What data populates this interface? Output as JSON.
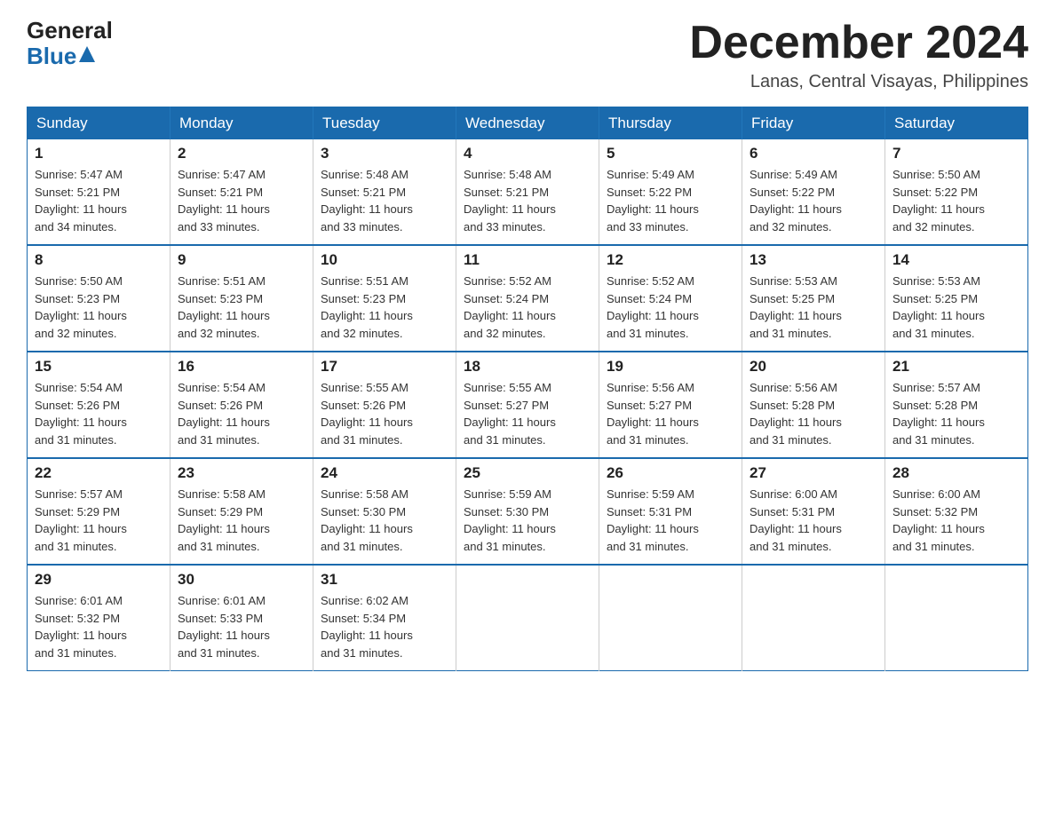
{
  "header": {
    "logo_general": "General",
    "logo_blue": "Blue",
    "month_title": "December 2024",
    "location": "Lanas, Central Visayas, Philippines"
  },
  "calendar": {
    "days_of_week": [
      "Sunday",
      "Monday",
      "Tuesday",
      "Wednesday",
      "Thursday",
      "Friday",
      "Saturday"
    ],
    "weeks": [
      [
        {
          "day": "1",
          "sunrise": "5:47 AM",
          "sunset": "5:21 PM",
          "daylight": "11 hours and 34 minutes."
        },
        {
          "day": "2",
          "sunrise": "5:47 AM",
          "sunset": "5:21 PM",
          "daylight": "11 hours and 33 minutes."
        },
        {
          "day": "3",
          "sunrise": "5:48 AM",
          "sunset": "5:21 PM",
          "daylight": "11 hours and 33 minutes."
        },
        {
          "day": "4",
          "sunrise": "5:48 AM",
          "sunset": "5:21 PM",
          "daylight": "11 hours and 33 minutes."
        },
        {
          "day": "5",
          "sunrise": "5:49 AM",
          "sunset": "5:22 PM",
          "daylight": "11 hours and 33 minutes."
        },
        {
          "day": "6",
          "sunrise": "5:49 AM",
          "sunset": "5:22 PM",
          "daylight": "11 hours and 32 minutes."
        },
        {
          "day": "7",
          "sunrise": "5:50 AM",
          "sunset": "5:22 PM",
          "daylight": "11 hours and 32 minutes."
        }
      ],
      [
        {
          "day": "8",
          "sunrise": "5:50 AM",
          "sunset": "5:23 PM",
          "daylight": "11 hours and 32 minutes."
        },
        {
          "day": "9",
          "sunrise": "5:51 AM",
          "sunset": "5:23 PM",
          "daylight": "11 hours and 32 minutes."
        },
        {
          "day": "10",
          "sunrise": "5:51 AM",
          "sunset": "5:23 PM",
          "daylight": "11 hours and 32 minutes."
        },
        {
          "day": "11",
          "sunrise": "5:52 AM",
          "sunset": "5:24 PM",
          "daylight": "11 hours and 32 minutes."
        },
        {
          "day": "12",
          "sunrise": "5:52 AM",
          "sunset": "5:24 PM",
          "daylight": "11 hours and 31 minutes."
        },
        {
          "day": "13",
          "sunrise": "5:53 AM",
          "sunset": "5:25 PM",
          "daylight": "11 hours and 31 minutes."
        },
        {
          "day": "14",
          "sunrise": "5:53 AM",
          "sunset": "5:25 PM",
          "daylight": "11 hours and 31 minutes."
        }
      ],
      [
        {
          "day": "15",
          "sunrise": "5:54 AM",
          "sunset": "5:26 PM",
          "daylight": "11 hours and 31 minutes."
        },
        {
          "day": "16",
          "sunrise": "5:54 AM",
          "sunset": "5:26 PM",
          "daylight": "11 hours and 31 minutes."
        },
        {
          "day": "17",
          "sunrise": "5:55 AM",
          "sunset": "5:26 PM",
          "daylight": "11 hours and 31 minutes."
        },
        {
          "day": "18",
          "sunrise": "5:55 AM",
          "sunset": "5:27 PM",
          "daylight": "11 hours and 31 minutes."
        },
        {
          "day": "19",
          "sunrise": "5:56 AM",
          "sunset": "5:27 PM",
          "daylight": "11 hours and 31 minutes."
        },
        {
          "day": "20",
          "sunrise": "5:56 AM",
          "sunset": "5:28 PM",
          "daylight": "11 hours and 31 minutes."
        },
        {
          "day": "21",
          "sunrise": "5:57 AM",
          "sunset": "5:28 PM",
          "daylight": "11 hours and 31 minutes."
        }
      ],
      [
        {
          "day": "22",
          "sunrise": "5:57 AM",
          "sunset": "5:29 PM",
          "daylight": "11 hours and 31 minutes."
        },
        {
          "day": "23",
          "sunrise": "5:58 AM",
          "sunset": "5:29 PM",
          "daylight": "11 hours and 31 minutes."
        },
        {
          "day": "24",
          "sunrise": "5:58 AM",
          "sunset": "5:30 PM",
          "daylight": "11 hours and 31 minutes."
        },
        {
          "day": "25",
          "sunrise": "5:59 AM",
          "sunset": "5:30 PM",
          "daylight": "11 hours and 31 minutes."
        },
        {
          "day": "26",
          "sunrise": "5:59 AM",
          "sunset": "5:31 PM",
          "daylight": "11 hours and 31 minutes."
        },
        {
          "day": "27",
          "sunrise": "6:00 AM",
          "sunset": "5:31 PM",
          "daylight": "11 hours and 31 minutes."
        },
        {
          "day": "28",
          "sunrise": "6:00 AM",
          "sunset": "5:32 PM",
          "daylight": "11 hours and 31 minutes."
        }
      ],
      [
        {
          "day": "29",
          "sunrise": "6:01 AM",
          "sunset": "5:32 PM",
          "daylight": "11 hours and 31 minutes."
        },
        {
          "day": "30",
          "sunrise": "6:01 AM",
          "sunset": "5:33 PM",
          "daylight": "11 hours and 31 minutes."
        },
        {
          "day": "31",
          "sunrise": "6:02 AM",
          "sunset": "5:34 PM",
          "daylight": "11 hours and 31 minutes."
        },
        null,
        null,
        null,
        null
      ]
    ],
    "sunrise_label": "Sunrise:",
    "sunset_label": "Sunset:",
    "daylight_label": "Daylight:"
  }
}
